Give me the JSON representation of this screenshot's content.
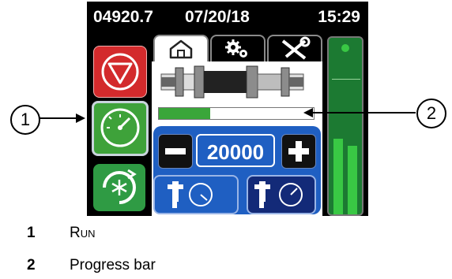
{
  "status_bar": {
    "counter": "04920.7",
    "date": "07/20/18",
    "time": "15:29"
  },
  "left_buttons": [
    {
      "name": "stop",
      "icon": "stop-triangle-icon",
      "color": "#d32a2c"
    },
    {
      "name": "run",
      "icon": "gauge-dial-icon",
      "color": "#3ea23a"
    },
    {
      "name": "defrost",
      "icon": "snowflake-cycle-icon",
      "color": "#2f9b44"
    }
  ],
  "tabs": [
    {
      "icon": "home-icon",
      "active": true
    },
    {
      "icon": "gears-icon",
      "active": false
    },
    {
      "icon": "tools-icon",
      "active": false
    }
  ],
  "progress": {
    "fraction": 0.33,
    "color": "#3aa63a"
  },
  "setpoint": {
    "value": "20000"
  },
  "modes": [
    {
      "icon": "fitting-gauge-icon",
      "selected": true
    },
    {
      "icon": "fitting-gauge-icon",
      "selected": false
    }
  ],
  "gauge": {
    "level_1": 0.43,
    "level_2": 0.39,
    "color": "#39c844"
  },
  "callouts": [
    "1",
    "2"
  ],
  "legend": [
    {
      "num": "1",
      "label": "Run"
    },
    {
      "num": "2",
      "label": "Progress bar"
    }
  ]
}
